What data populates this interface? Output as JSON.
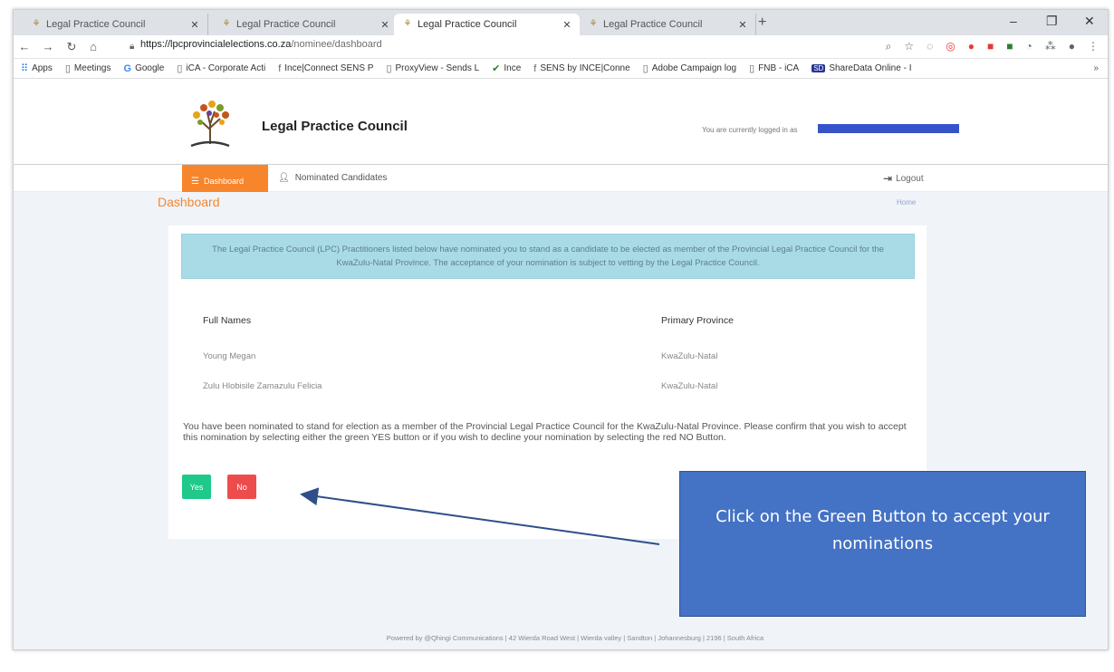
{
  "browser": {
    "tabs": [
      {
        "label": "Legal Practice Council"
      },
      {
        "label": "Legal Practice Council"
      },
      {
        "label": "Legal Practice Council"
      },
      {
        "label": "Legal Practice Council"
      }
    ],
    "url_host": "https://lpcprovincialelections.co.za",
    "url_path": "/nominee/dashboard",
    "bookmarks": [
      {
        "label": "Apps",
        "icon": "apps-grid-icon"
      },
      {
        "label": "Meetings",
        "icon": "page-icon"
      },
      {
        "label": "Google",
        "icon": "google-icon"
      },
      {
        "label": "iCA - Corporate Acti",
        "icon": "page-icon"
      },
      {
        "label": "Ince|Connect SENS P",
        "icon": "ince-icon"
      },
      {
        "label": "ProxyView - Sends L",
        "icon": "page-icon"
      },
      {
        "label": "Ince",
        "icon": "check-icon"
      },
      {
        "label": "SENS by INCE|Conne",
        "icon": "ince-icon"
      },
      {
        "label": "Adobe Campaign log",
        "icon": "page-icon"
      },
      {
        "label": "FNB - iCA",
        "icon": "page-icon"
      },
      {
        "label": "ShareData Online - I",
        "icon": "sharedata-icon"
      }
    ]
  },
  "site": {
    "title": "Legal Practice Council",
    "login_text": "You are currently logged in as"
  },
  "nav": {
    "dashboard": "Dashboard",
    "nominated": "Nominated Candidates",
    "logout": "Logout"
  },
  "page": {
    "heading": "Dashboard",
    "breadcrumb": "Home",
    "alert": "The Legal Practice Council (LPC) Practitioners listed below have nominated you to stand as a candidate to be elected as member of the Provincial Legal Practice Council for the KwaZulu-Natal Province. The acceptance of your nomination is subject to vetting by the Legal Practice Council.",
    "table": {
      "headers": [
        "Full Names",
        "Primary Province"
      ],
      "rows": [
        [
          "Young Megan",
          "KwaZulu-Natal"
        ],
        [
          "Zulu Hlobisile Zamazulu Felicia",
          "KwaZulu-Natal"
        ]
      ]
    },
    "message": "You have been nominated to stand for election as a member of the Provincial Legal Practice Council for the KwaZulu-Natal Province. Please confirm that you wish to accept this nomination by selecting either the green YES button or if you wish to decline your nomination by selecting the red NO Button.",
    "yes_label": "Yes",
    "no_label": "No"
  },
  "footer": "Powered by @Qhingi Communications | 42 Wierda Road West | Wierda valley | Sandton | Johannesburg | 2196 | South Africa",
  "annotation": "Click on the Green Button to accept your nominations",
  "colors": {
    "accent_orange": "#f7852b",
    "yes_green": "#1ec98a",
    "no_red": "#ee4c4c",
    "callout_blue": "#4472c4"
  }
}
